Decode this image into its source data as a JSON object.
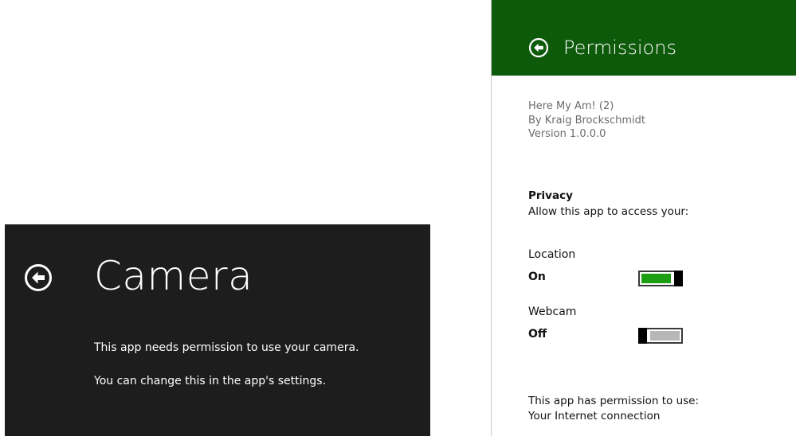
{
  "camera_dialog": {
    "back_icon": "back-arrow-circle-icon",
    "title": "Camera",
    "message_1": "This app needs permission to use your camera.",
    "message_2": "You can change this in the app's settings.",
    "background_color": "#1d1d1d"
  },
  "permissions_pane": {
    "back_icon": "back-arrow-circle-icon",
    "title": "Permissions",
    "header_color": "#0e5a0b",
    "app_info": {
      "name": "Here My Am! (2)",
      "author": "By Kraig Brockschmidt",
      "version": "Version 1.0.0.0"
    },
    "privacy": {
      "heading": "Privacy",
      "description": "Allow this app to access your:"
    },
    "settings": [
      {
        "label": "Location",
        "state_text": "On",
        "on": true
      },
      {
        "label": "Webcam",
        "state_text": "Off",
        "on": false
      }
    ],
    "permissions_heading": "This app has permission to use:",
    "permissions": [
      "Your Internet connection"
    ],
    "toggle_on_color": "#1d9e13",
    "toggle_off_color": "#b7b7b7"
  }
}
